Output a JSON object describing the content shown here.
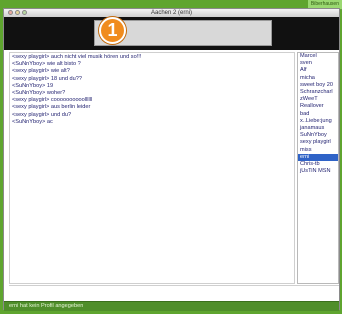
{
  "window": {
    "title": "Aachen 2 (erni)"
  },
  "corner_ribbon": {
    "label": "Biberhausen"
  },
  "topbar": {
    "badge_number": "1"
  },
  "chat": {
    "lines": [
      "<sexy playgirl> auch nicht viel musik hören und so!!!",
      "<SuNnYboy> wie alt bisto ?",
      "<sexy playgirl> wie alt?",
      "<sexy playgirl> 18 und du??",
      "<SuNnYboy> 19",
      "<SuNnYboy> woher?",
      "<sexy playgirl> coooooooooollllll",
      "<sexy playgirl> aus berlin leider",
      "<sexy playgirl> und du?",
      "<SuNnYboy> ac"
    ]
  },
  "users": [
    {
      "name": "Marcel"
    },
    {
      "name": "sven"
    },
    {
      "name": "Alf"
    },
    {
      "name": "micha"
    },
    {
      "name": "sweet boy 20"
    },
    {
      "name": "Schranzcharl"
    },
    {
      "name": "zWeeT"
    },
    {
      "name": "Reallover"
    },
    {
      "name": "bad"
    },
    {
      "name": "x..Liebe:jung"
    },
    {
      "name": "janamaus"
    },
    {
      "name": "SuNnYboy"
    },
    {
      "name": "sexy playgirl"
    },
    {
      "name": "miss"
    },
    {
      "name": "erni"
    },
    {
      "name": "Chris-tb"
    },
    {
      "name": "jUsTiN MSN"
    }
  ],
  "selected_user_index": 14,
  "status": {
    "text": "erni hat kein Profil angegeben"
  },
  "colors": {
    "desktop": "#5fa52f",
    "topbar": "#111111",
    "badge": "#f08c1e",
    "selection": "#2f63c7",
    "statusbar": "#4f8e2a"
  }
}
